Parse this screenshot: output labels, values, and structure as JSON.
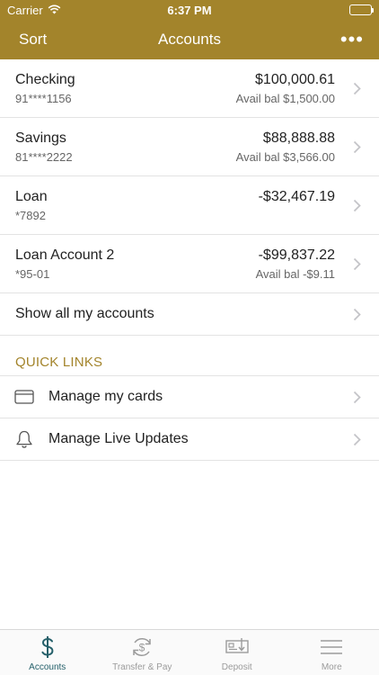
{
  "status_bar": {
    "carrier": "Carrier",
    "time": "6:37 PM"
  },
  "nav": {
    "left_label": "Sort",
    "title": "Accounts",
    "more_label": "•••"
  },
  "accounts": [
    {
      "name": "Checking",
      "number": "91****1156",
      "balance": "$100,000.61",
      "available": "Avail bal $1,500.00"
    },
    {
      "name": "Savings",
      "number": "81****2222",
      "balance": "$88,888.88",
      "available": "Avail bal $3,566.00"
    },
    {
      "name": "Loan",
      "number": "*7892",
      "balance": "-$32,467.19",
      "available": ""
    },
    {
      "name": "Loan Account 2",
      "number": "*95-01",
      "balance": "-$99,837.22",
      "available": "Avail bal -$9.11"
    }
  ],
  "show_all_label": "Show all my accounts",
  "quick_links": {
    "heading": "QUICK LINKS",
    "items": [
      {
        "label": "Manage my cards",
        "icon": "card-icon"
      },
      {
        "label": "Manage Live Updates",
        "icon": "bell-icon"
      }
    ]
  },
  "tabs": [
    {
      "label": "Accounts",
      "icon": "dollar-icon",
      "active": true
    },
    {
      "label": "Transfer & Pay",
      "icon": "transfer-icon",
      "active": false
    },
    {
      "label": "Deposit",
      "icon": "check-deposit-icon",
      "active": false
    },
    {
      "label": "More",
      "icon": "menu-icon",
      "active": false
    }
  ],
  "colors": {
    "brand": "#a3842b",
    "active_tab": "#25606a",
    "inactive_tab": "#9b9b9b"
  }
}
